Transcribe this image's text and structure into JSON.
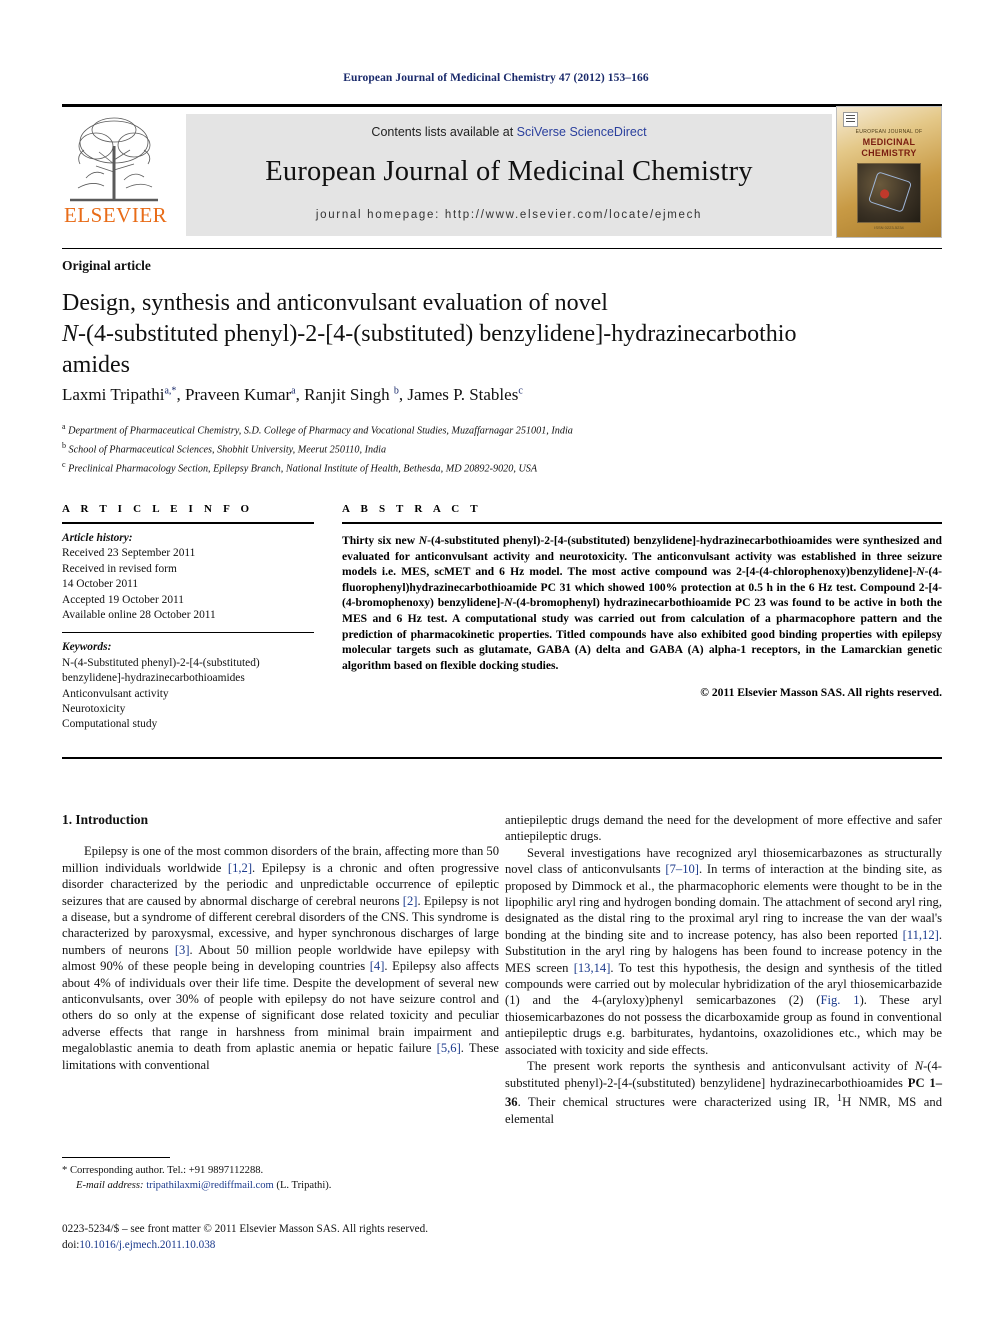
{
  "running_head": "European Journal of Medicinal Chemistry 47 (2012) 153–166",
  "masthead": {
    "contents_prefix": "Contents lists available at ",
    "sciencedirect": "SciVerse ScienceDirect",
    "journal_title": "European Journal of Medicinal Chemistry",
    "homepage": "journal homepage: http://www.elsevier.com/locate/ejmech",
    "publisher_wordmark": "ELSEVIER",
    "publisher_color": "#e86c18",
    "link_color": "#2a3f9d",
    "banner_bg": "#e4e4e4",
    "cover": {
      "line1": "EUROPEAN JOURNAL OF",
      "line2": "MEDICINAL",
      "line3": "CHEMISTRY",
      "caption": "ISSN 0223-5234"
    }
  },
  "article_type": "Original article",
  "title": {
    "line1": "Design, synthesis and anticonvulsant evaluation of novel",
    "line2_italic": "N",
    "line2_rest": "-(4-substituted phenyl)-2-[4-(substituted) benzylidene]-hydrazinecarbothio",
    "line3": "amides"
  },
  "authors": [
    {
      "name": "Laxmi Tripathi",
      "sup": "a,*"
    },
    {
      "name": "Praveen Kumar",
      "sup": "a"
    },
    {
      "name": "Ranjit Singh",
      "sup": "b"
    },
    {
      "name": "James P. Stables",
      "sup": "c"
    }
  ],
  "affiliations": [
    {
      "mark": "a",
      "text": "Department of Pharmaceutical Chemistry, S.D. College of Pharmacy and Vocational Studies, Muzaffarnagar 251001, India"
    },
    {
      "mark": "b",
      "text": "School of Pharmaceutical Sciences, Shobhit University, Meerut 250110, India"
    },
    {
      "mark": "c",
      "text": "Preclinical Pharmacology Section, Epilepsy Branch, National Institute of Health, Bethesda, MD 20892-9020, USA"
    }
  ],
  "article_info": {
    "heading": "A R T I C L E   I N F O",
    "history_label": "Article history:",
    "history": [
      "Received 23 September 2011",
      "Received in revised form",
      "14 October 2011",
      "Accepted 19 October 2011",
      "Available online 28 October 2011"
    ],
    "keywords_label": "Keywords:",
    "keywords": [
      "N-(4-Substituted phenyl)-2-[4-(substituted)",
      "benzylidene]-hydrazinecarbothioamides",
      "Anticonvulsant activity",
      "Neurotoxicity",
      "Computational study"
    ]
  },
  "abstract": {
    "heading": "A B S T R A C T",
    "body": "Thirty six new N-(4-substituted phenyl)-2-[4-(substituted) benzylidene]-hydrazinecarbothioamides were synthesized and evaluated for anticonvulsant activity and neurotoxicity. The anticonvulsant activity was established in three seizure models i.e. MES, scMET and 6 Hz model. The most active compound was 2-[4-(4-chlorophenoxy)benzylidene]-N-(4-fluorophenyl)hydrazinecarbothioamide PC 31 which showed 100% protection at 0.5 h in the 6 Hz test. Compound 2-[4-(4-bromophenoxy) benzylidene]-N-(4-bromophenyl) hydrazinecarbothioamide PC 23 was found to be active in both the MES and 6 Hz test. A computational study was carried out from calculation of a pharmacophore pattern and the prediction of pharmacokinetic properties. Titled compounds have also exhibited good binding properties with epilepsy molecular targets such as glutamate, GABA (A) delta and GABA (A) alpha-1 receptors, in the Lamarckian genetic algorithm based on flexible docking studies.",
    "copyright": "© 2011 Elsevier Masson SAS. All rights reserved."
  },
  "body": {
    "section_heading": "1.  Introduction",
    "left_paragraphs": [
      "Epilepsy is one of the most common disorders of the brain, affecting more than 50 million individuals worldwide [1,2]. Epilepsy is a chronic and often progressive disorder characterized by the periodic and unpredictable occurrence of epileptic seizures that are caused by abnormal discharge of cerebral neurons [2]. Epilepsy is not a disease, but a syndrome of different cerebral disorders of the CNS. This syndrome is characterized by paroxysmal, excessive, and hyper synchronous discharges of large numbers of neurons [3]. About 50 million people worldwide have epilepsy with almost 90% of these people being in developing countries [4]. Epilepsy also affects about 4% of individuals over their life time. Despite the development of several new anticonvulsants, over 30% of people with epilepsy do not have seizure control and others do so only at the expense of significant dose related toxicity and peculiar adverse effects that range in harshness from minimal brain impairment and megaloblastic anemia to death from aplastic anemia or hepatic failure [5,6]. These limitations with conventional"
    ],
    "right_paragraphs": [
      "antiepileptic drugs demand the need for the development of more effective and safer antiepileptic drugs.",
      "Several investigations have recognized aryl thiosemicarbazones as structurally novel class of anticonvulsants [7–10]. In terms of interaction at the binding site, as proposed by Dimmock et al., the pharmacophoric elements were thought to be in the lipophilic aryl ring and hydrogen bonding domain. The attachment of second aryl ring, designated as the distal ring to the proximal aryl ring to increase the van der waal's bonding at the binding site and to increase potency, has also been reported [11,12]. Substitution in the aryl ring by halogens has been found to increase potency in the MES screen [13,14]. To test this hypothesis, the design and synthesis of the titled compounds were carried out by molecular hybridization of the aryl thiosemicarbazide (1) and the 4-(aryloxy)phenyl semicarbazones (2) (Fig. 1). These aryl thiosemicarbazones do not possess the dicarboxamide group as found in conventional antiepileptic drugs e.g. barbiturates, hydantoins, oxazolidiones etc., which may be associated with toxicity and side effects.",
      "The present work reports the synthesis and anticonvulsant activity of N-(4-substituted phenyl)-2-[4-(substituted) benzylidene] hydrazinecarbothioamides PC 1–36. Their chemical structures were characterized using IR, 1H NMR, MS and elemental"
    ]
  },
  "footnotes": {
    "corresponding": "* Corresponding author. Tel.: +91 9897112288.",
    "email_label": "E-mail address:",
    "email": "tripathilaxmi@rediffmail.com",
    "email_suffix": " (L. Tripathi).",
    "imprint_line1": "0223-5234/$ – see front matter © 2011 Elsevier Masson SAS. All rights reserved.",
    "doi_label": "doi:",
    "doi": "10.1016/j.ejmech.2011.10.038",
    "link_color": "#1b3a8c"
  }
}
